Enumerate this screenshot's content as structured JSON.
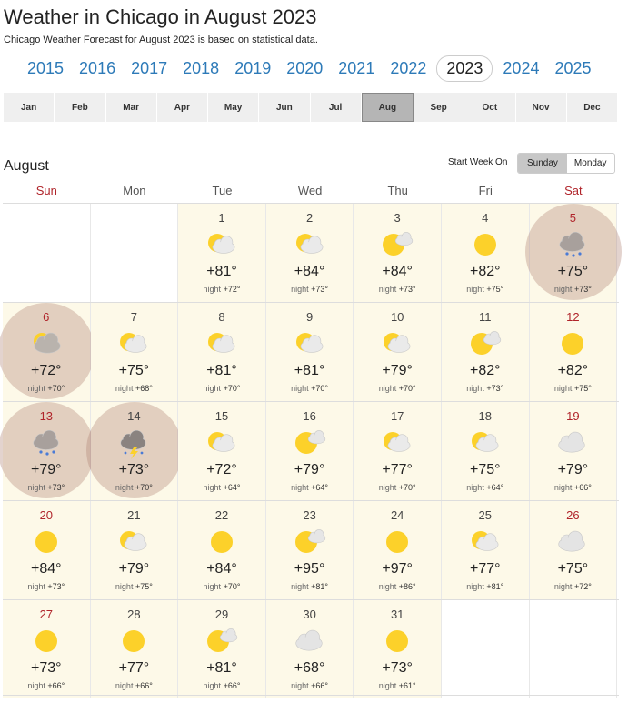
{
  "header": {
    "title": "Weather in Chicago in August 2023",
    "subtitle": "Chicago Weather Forecast for August 2023 is based on statistical data."
  },
  "years": [
    "2015",
    "2016",
    "2017",
    "2018",
    "2019",
    "2020",
    "2021",
    "2022",
    "2023",
    "2024",
    "2025"
  ],
  "active_year": "2023",
  "months": [
    "Jan",
    "Feb",
    "Mar",
    "Apr",
    "May",
    "Jun",
    "Jul",
    "Aug",
    "Sep",
    "Oct",
    "Nov",
    "Dec"
  ],
  "active_month": "Aug",
  "month_heading": "August",
  "start_week": {
    "label": "Start Week On",
    "options": [
      "Sunday",
      "Monday"
    ],
    "selected": "Sunday"
  },
  "weekdays": [
    "Sun",
    "Mon",
    "Tue",
    "Wed",
    "Thu",
    "Fri",
    "Sat"
  ],
  "night_label": "night",
  "colors": {
    "link": "#2d7ab8",
    "weekend": "#b0242a",
    "cell_bg": "#fdf9e8",
    "highlight": "#b08074"
  },
  "weeks": [
    [
      null,
      null,
      {
        "day": "1",
        "icon": "partly-cloudy",
        "high": "+81°",
        "night": "+72°"
      },
      {
        "day": "2",
        "icon": "partly-cloudy",
        "high": "+84°",
        "night": "+73°"
      },
      {
        "day": "3",
        "icon": "sun-small-cloud",
        "high": "+84°",
        "night": "+73°"
      },
      {
        "day": "4",
        "icon": "sunny",
        "high": "+82°",
        "night": "+75°"
      },
      {
        "day": "5",
        "icon": "rain",
        "high": "+75°",
        "night": "+73°",
        "highlight": true
      }
    ],
    [
      {
        "day": "6",
        "icon": "mostly-cloudy",
        "high": "+72°",
        "night": "+70°",
        "highlight": true
      },
      {
        "day": "7",
        "icon": "partly-cloudy",
        "high": "+75°",
        "night": "+68°"
      },
      {
        "day": "8",
        "icon": "partly-cloudy",
        "high": "+81°",
        "night": "+70°"
      },
      {
        "day": "9",
        "icon": "partly-cloudy",
        "high": "+81°",
        "night": "+70°"
      },
      {
        "day": "10",
        "icon": "partly-cloudy",
        "high": "+79°",
        "night": "+70°"
      },
      {
        "day": "11",
        "icon": "sun-small-cloud",
        "high": "+82°",
        "night": "+73°"
      },
      {
        "day": "12",
        "icon": "sunny",
        "high": "+82°",
        "night": "+75°"
      }
    ],
    [
      {
        "day": "13",
        "icon": "rain",
        "high": "+79°",
        "night": "+73°",
        "highlight": true
      },
      {
        "day": "14",
        "icon": "thunder",
        "high": "+73°",
        "night": "+70°",
        "highlight": true
      },
      {
        "day": "15",
        "icon": "partly-cloudy",
        "high": "+72°",
        "night": "+64°"
      },
      {
        "day": "16",
        "icon": "sun-small-cloud",
        "high": "+79°",
        "night": "+64°"
      },
      {
        "day": "17",
        "icon": "partly-cloudy",
        "high": "+77°",
        "night": "+70°"
      },
      {
        "day": "18",
        "icon": "partly-cloudy",
        "high": "+75°",
        "night": "+64°"
      },
      {
        "day": "19",
        "icon": "cloudy",
        "high": "+79°",
        "night": "+66°"
      }
    ],
    [
      {
        "day": "20",
        "icon": "sunny",
        "high": "+84°",
        "night": "+73°"
      },
      {
        "day": "21",
        "icon": "partly-cloudy",
        "high": "+79°",
        "night": "+75°"
      },
      {
        "day": "22",
        "icon": "sunny",
        "high": "+84°",
        "night": "+70°"
      },
      {
        "day": "23",
        "icon": "sun-small-cloud",
        "high": "+95°",
        "night": "+81°"
      },
      {
        "day": "24",
        "icon": "sunny",
        "high": "+97°",
        "night": "+86°"
      },
      {
        "day": "25",
        "icon": "partly-cloudy",
        "high": "+77°",
        "night": "+81°"
      },
      {
        "day": "26",
        "icon": "cloudy",
        "high": "+75°",
        "night": "+72°"
      }
    ],
    [
      {
        "day": "27",
        "icon": "sunny",
        "high": "+73°",
        "night": "+66°"
      },
      {
        "day": "28",
        "icon": "sunny",
        "high": "+77°",
        "night": "+66°"
      },
      {
        "day": "29",
        "icon": "sun-small-cloud",
        "high": "+81°",
        "night": "+66°"
      },
      {
        "day": "30",
        "icon": "cloudy",
        "high": "+68°",
        "night": "+66°"
      },
      {
        "day": "31",
        "icon": "sunny",
        "high": "+73°",
        "night": "+61°"
      },
      null,
      null
    ]
  ]
}
